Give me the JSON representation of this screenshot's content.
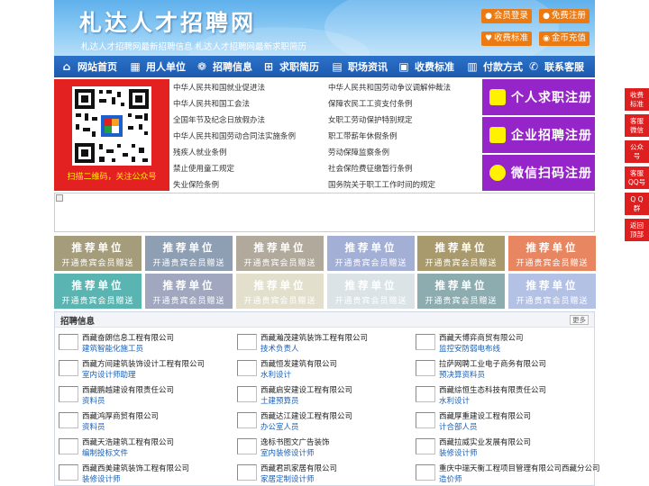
{
  "header": {
    "title": "札达人才招聘网",
    "subtitle": "札达人才招聘网最新招聘信息   札达人才招聘网最新求职简历",
    "buttons": [
      {
        "label": "会员登录",
        "icon": "user-icon"
      },
      {
        "label": "免费注册",
        "icon": "user-add-icon"
      },
      {
        "label": "收费标准",
        "icon": "tag-icon"
      },
      {
        "label": "金币充值",
        "icon": "coin-icon"
      }
    ],
    "colors": {
      "button": "#ec7a12",
      "bg_top": "#5fb0ec",
      "title": "#ffffff"
    }
  },
  "nav": {
    "items": [
      {
        "label": "网站首页",
        "icon": "home-icon"
      },
      {
        "label": "用人单位",
        "icon": "building-icon"
      },
      {
        "label": "招聘信息",
        "icon": "recruit-icon"
      },
      {
        "label": "求职简历",
        "icon": "resume-icon"
      },
      {
        "label": "职场资讯",
        "icon": "news-icon"
      },
      {
        "label": "收费标准",
        "icon": "fee-icon"
      },
      {
        "label": "付款方式",
        "icon": "payment-icon"
      },
      {
        "label": "联系客服",
        "icon": "phone-icon"
      }
    ]
  },
  "qr": {
    "caption": "扫描二维码，关注公众号"
  },
  "laws": [
    "中华人民共和国就业促进法",
    "中华人民共和国劳动争议调解仲裁法",
    "中华人民共和国工会法",
    "保障农民工工资支付条例",
    "全国年节及纪念日放假办法",
    "女职工劳动保护特别规定",
    "中华人民共和国劳动合同法实施条例",
    "职工带薪年休假条例",
    "残疾人就业条例",
    "劳动保障监察条例",
    "禁止使用童工规定",
    "社会保险费征缴暂行条例",
    "失业保险条例",
    "国务院关于职工工作时间的规定"
  ],
  "register": [
    {
      "label": "个人求职注册",
      "icon": "person-icon"
    },
    {
      "label": "企业招聘注册",
      "icon": "company-icon"
    },
    {
      "label": "微信扫码注册",
      "icon": "wechat-icon"
    }
  ],
  "tiles": {
    "line1": "推荐单位",
    "line2": "开通贵宾会员赠送",
    "colors": [
      "#a59c7c",
      "#8f9fb3",
      "#b1a99b",
      "#a3afd4",
      "#a99a6e",
      "#e88662",
      "#5ab5b2",
      "#a0a7be",
      "#e3dfcd",
      "#dbe3e7",
      "#8dacb0",
      "#b3c1e5"
    ]
  },
  "jobs": {
    "title": "招聘信息",
    "more": "更多",
    "items": [
      {
        "company": "西藏奋朗信息工程有限公司",
        "position": "建筑智能化施工员"
      },
      {
        "company": "西藏瀚茂建筑装饰工程有限公司",
        "position": "技术负责人"
      },
      {
        "company": "西藏天博弈商贸有限公司",
        "position": "监控安防弱电布线"
      },
      {
        "company": "西藏方间建筑装饰设计工程有限公司",
        "position": "室内设计师助理"
      },
      {
        "company": "西藏恒发建筑有限公司",
        "position": "水利设计"
      },
      {
        "company": "拉萨网聘工业电子商务有限公司",
        "position": "预决算资料员"
      },
      {
        "company": "西藏鹏越建设有限责任公司",
        "position": "资料员"
      },
      {
        "company": "西藏启安建设工程有限公司",
        "position": "土建预算员"
      },
      {
        "company": "西藏综恒生态科技有限责任公司",
        "position": "水利设计"
      },
      {
        "company": "西藏鸿厚商贸有限公司",
        "position": "资料员"
      },
      {
        "company": "西藏达江建设工程有限公司",
        "position": "办公室人员"
      },
      {
        "company": "西藏厚重建设工程有限公司",
        "position": "计合部人员"
      },
      {
        "company": "西藏天浩建筑工程有限公司",
        "position": "编制投标文件"
      },
      {
        "company": "逸标书图文广告装饰",
        "position": "室内装修设计师"
      },
      {
        "company": "西藏拉威实业发展有限公司",
        "position": "装修设计师"
      },
      {
        "company": "西藏西美建筑装饰工程有限公司",
        "position": "装修设计师"
      },
      {
        "company": "西藏君凯家居有限公司",
        "position": "家居定制设计师"
      },
      {
        "company": "重庆中瑞天衡工程项目管理有限公司西藏分公司",
        "position": "造价师"
      }
    ]
  },
  "side": [
    {
      "label": "收费\n标准",
      "icon": "fee-side-icon"
    },
    {
      "label": "客服\n微信",
      "icon": "wechat-side-icon"
    },
    {
      "label": "公众\n号",
      "icon": "mp-side-icon"
    },
    {
      "label": "客服\nQQ号",
      "icon": "qq-side-icon"
    },
    {
      "label": "Q Q\n群",
      "icon": "qqgroup-side-icon"
    },
    {
      "label": "返回\n顶部",
      "icon": "top-side-icon"
    }
  ]
}
